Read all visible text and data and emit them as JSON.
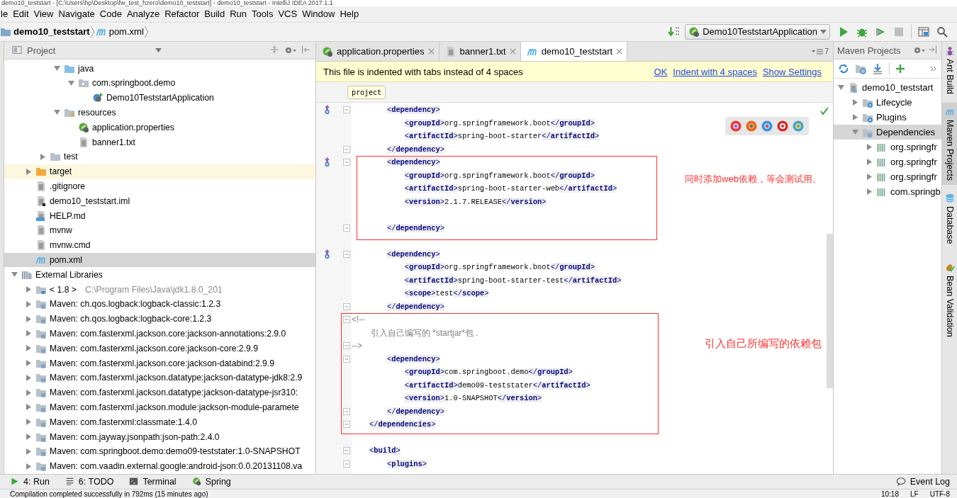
{
  "window": {
    "title": "demo10_teststart - [C:\\Users\\hp\\Desktop\\fw_test_hzero\\demo10_teststart] - demo10_teststart - IntelliJ IDEA 2017.1.1"
  },
  "menu": [
    "le",
    "Edit",
    "View",
    "Navigate",
    "Code",
    "Analyze",
    "Refactor",
    "Build",
    "Run",
    "Tools",
    "VCS",
    "Window",
    "Help"
  ],
  "navigation": {
    "breadcrumbs": [
      {
        "label": "demo10_teststart",
        "kind": "project"
      },
      {
        "label": "pom.xml",
        "kind": "maven"
      }
    ],
    "run_config": "Demo10TeststartApplication"
  },
  "project_panel": {
    "title": "Project",
    "tree": [
      {
        "children": [
          {
            "children": [
              {
                "children": [
                  {
                    "label": "java",
                    "kind": "source",
                    "expanded": true,
                    "selected": false,
                    "excluded": false,
                    "children": [
                      {
                        "label": "com.springboot.demo",
                        "kind": "package",
                        "expanded": true,
                        "selected": false,
                        "excluded": false,
                        "children": [
                          {
                            "label": "Demo10TeststartApplication",
                            "kind": "class",
                            "selected": false,
                            "excluded": false
                          }
                        ]
                      }
                    ]
                  },
                  {
                    "label": "resources",
                    "kind": "resources",
                    "expanded": true,
                    "selected": false,
                    "excluded": false,
                    "children": [
                      {
                        "label": "application.properties",
                        "kind": "spring",
                        "selected": false,
                        "excluded": false
                      },
                      {
                        "label": "banner1.txt",
                        "kind": "text",
                        "selected": false,
                        "excluded": false
                      }
                    ]
                  }
                ]
              },
              {
                "label": "test",
                "kind": "folder",
                "expanded": false,
                "selected": false,
                "excluded": false
              }
            ]
          },
          {
            "label": "target",
            "kind": "target",
            "expanded": false,
            "selected": false,
            "excluded": true
          },
          {
            "label": ".gitignore",
            "kind": "text",
            "selected": false,
            "excluded": false
          },
          {
            "label": "demo10_teststart.iml",
            "kind": "iml",
            "selected": false,
            "excluded": false
          },
          {
            "label": "HELP.md",
            "kind": "md",
            "selected": false,
            "excluded": false
          },
          {
            "label": "mvnw",
            "kind": "text",
            "selected": false,
            "excluded": false
          },
          {
            "label": "mvnw.cmd",
            "kind": "text",
            "selected": false,
            "excluded": false
          },
          {
            "label": "pom.xml",
            "kind": "maven",
            "selected": true,
            "excluded": false
          }
        ]
      },
      {
        "label": "External Libraries",
        "kind": "libraries",
        "expanded": true,
        "selected": false,
        "excluded": false,
        "children": [
          {
            "label": "< 1.8 >",
            "detail": "C:\\Program Files\\Java\\jdk1.8.0_201",
            "kind": "jdk",
            "expanded": false,
            "selected": false,
            "excluded": false
          },
          {
            "label": "Maven: ch.qos.logback:logback-classic:1.2.3",
            "kind": "library",
            "expanded": false,
            "selected": false,
            "excluded": false
          },
          {
            "label": "Maven: ch.qos.logback:logback-core:1.2.3",
            "kind": "library",
            "expanded": false,
            "selected": false,
            "excluded": false
          },
          {
            "label": "Maven: com.fasterxml.jackson.core:jackson-annotations:2.9.0",
            "kind": "library",
            "expanded": false,
            "selected": false,
            "excluded": false
          },
          {
            "label": "Maven: com.fasterxml.jackson.core:jackson-core:2.9.9",
            "kind": "library",
            "expanded": false,
            "selected": false,
            "excluded": false
          },
          {
            "label": "Maven: com.fasterxml.jackson.core:jackson-databind:2.9.9",
            "kind": "library",
            "expanded": false,
            "selected": false,
            "excluded": false
          },
          {
            "label": "Maven: com.fasterxml.jackson.datatype:jackson-datatype-jdk8:2.9",
            "kind": "library",
            "expanded": false,
            "selected": false,
            "excluded": false
          },
          {
            "label": "Maven: com.fasterxml.jackson.datatype:jackson-datatype-jsr310:",
            "kind": "library",
            "expanded": false,
            "selected": false,
            "excluded": false
          },
          {
            "label": "Maven: com.fasterxml.jackson.module:jackson-module-paramete",
            "kind": "library",
            "expanded": false,
            "selected": false,
            "excluded": false
          },
          {
            "label": "Maven: com.fasterxml:classmate:1.4.0",
            "kind": "library",
            "expanded": false,
            "selected": false,
            "excluded": false
          },
          {
            "label": "Maven: com.jayway.jsonpath:json-path:2.4.0",
            "kind": "library",
            "expanded": false,
            "selected": false,
            "excluded": false
          },
          {
            "label": "Maven: com.springboot.demo:demo09-teststater:1.0-SNAPSHOT",
            "kind": "library",
            "expanded": false,
            "selected": false,
            "excluded": false
          },
          {
            "label": "Maven: com.vaadin.external.google:android-json:0.0.20131108.va",
            "kind": "library",
            "expanded": false,
            "selected": false,
            "excluded": false
          }
        ]
      }
    ]
  },
  "editor": {
    "tabs": [
      {
        "label": "application.properties",
        "kind": "spring",
        "selected": false
      },
      {
        "label": "banner1.txt",
        "kind": "text",
        "selected": false
      },
      {
        "label": "demo10_teststart",
        "kind": "maven",
        "selected": true
      }
    ],
    "tab_count": "7",
    "notice": {
      "text": "This file is indented with tabs instead of 4 spaces",
      "links": [
        "OK",
        "Indent with 4 spaces",
        "Show Settings"
      ]
    },
    "breadcrumb": "project",
    "blocks": [
      {
        "kind": "plain",
        "lines": [
          {
            "kind": "code",
            "text": "        <dependency>",
            "override": true,
            "fold": true
          },
          {
            "kind": "code",
            "text": "            <groupId>org.springframework.boot</groupId>",
            "override": false,
            "fold": false
          },
          {
            "kind": "code",
            "text": "            <artifactId>spring-boot-starter</artifactId>",
            "override": false,
            "fold": false
          },
          {
            "kind": "code",
            "text": "        </dependency>",
            "override": false,
            "fold": true
          }
        ]
      },
      {
        "kind": "annotated",
        "note": "同时添加web依赖，等会测试用。",
        "lines": [
          {
            "kind": "code",
            "text": "        <dependency>",
            "override": true,
            "fold": true
          },
          {
            "kind": "code",
            "text": "            <groupId>org.springframework.boot</groupId>",
            "override": false,
            "fold": false
          },
          {
            "kind": "code",
            "text": "            <artifactId>spring-boot-starter-web</artifactId>",
            "override": false,
            "fold": false
          },
          {
            "kind": "code",
            "text": "            <version>2.1.7.RELEASE</version>",
            "override": false,
            "fold": false
          },
          {
            "kind": "blank",
            "override": false,
            "fold": false
          },
          {
            "kind": "code",
            "text": "        </dependency>",
            "override": false,
            "fold": true
          }
        ]
      },
      {
        "kind": "plain",
        "lines": [
          {
            "kind": "blank",
            "override": false,
            "fold": false
          },
          {
            "kind": "code",
            "text": "        <dependency>",
            "override": true,
            "fold": true
          },
          {
            "kind": "code",
            "text": "            <groupId>org.springframework.boot</groupId>",
            "override": false,
            "fold": false
          },
          {
            "kind": "code",
            "text": "            <artifactId>spring-boot-starter-test</artifactId>",
            "override": false,
            "fold": false
          },
          {
            "kind": "code",
            "text": "            <scope>test</scope>",
            "override": false,
            "fold": false
          },
          {
            "kind": "code",
            "text": "        </dependency>",
            "override": false,
            "fold": true
          }
        ]
      },
      {
        "kind": "annotated",
        "note": "引入自己所编写的依赖包",
        "lines": [
          {
            "kind": "comment",
            "text": "<!--",
            "override": false,
            "fold": true
          },
          {
            "kind": "comment",
            "text": "        引入自己编写的 *startjar*包 .",
            "override": false,
            "fold": false
          },
          {
            "kind": "comment",
            "text": "-->",
            "override": false,
            "fold": true
          },
          {
            "kind": "code",
            "text": "        <dependency>",
            "override": false,
            "fold": true
          },
          {
            "kind": "code",
            "text": "            <groupId>com.springboot.demo</groupId>",
            "override": false,
            "fold": false
          },
          {
            "kind": "code",
            "text": "            <artifactId>demo09-teststater</artifactId>",
            "override": false,
            "fold": false
          },
          {
            "kind": "code",
            "text": "            <version>1.0-SNAPSHOT</version>",
            "override": false,
            "fold": false
          },
          {
            "kind": "code",
            "text": "        </dependency>",
            "override": false,
            "fold": true
          },
          {
            "kind": "code",
            "text": "    </dependencies>",
            "override": false,
            "fold": true
          }
        ]
      },
      {
        "kind": "plain",
        "lines": [
          {
            "kind": "blank",
            "override": false,
            "fold": false
          },
          {
            "kind": "code",
            "text": "    <build>",
            "override": false,
            "fold": true
          },
          {
            "kind": "code",
            "text": "        <plugins>",
            "override": false,
            "fold": true
          }
        ]
      }
    ]
  },
  "maven_panel": {
    "title": "Maven Projects",
    "tree": [
      {
        "label": "demo10_teststart",
        "kind": "module",
        "expanded": true,
        "selected": false,
        "children": [
          {
            "label": "Lifecycle",
            "kind": "config-folder",
            "expanded": false,
            "selected": false
          },
          {
            "label": "Plugins",
            "kind": "config-folder",
            "expanded": false,
            "selected": false
          },
          {
            "label": "Dependencies",
            "kind": "deps-folder",
            "expanded": true,
            "selected": true,
            "children": [
              {
                "label": "org.springfr",
                "kind": "dependency",
                "expanded": false,
                "selected": false
              },
              {
                "label": "org.springfr",
                "kind": "dependency",
                "expanded": false,
                "selected": false
              },
              {
                "label": "org.springfr",
                "kind": "dependency",
                "expanded": false,
                "selected": false
              },
              {
                "label": "com.springb",
                "kind": "dependency",
                "expanded": false,
                "selected": false
              }
            ]
          }
        ]
      }
    ]
  },
  "side_tabs": [
    {
      "label": "Ant Build",
      "kind": "ant",
      "selected": false
    },
    {
      "label": "Maven Projects",
      "kind": "maven",
      "selected": true
    },
    {
      "label": "Database",
      "kind": "database",
      "selected": false
    },
    {
      "label": "Bean Validation",
      "kind": "bean",
      "selected": false
    }
  ],
  "tool_windows": [
    {
      "label": "4: Run",
      "kind": "run"
    },
    {
      "label": "6: TODO",
      "kind": "todo"
    },
    {
      "label": "Terminal",
      "kind": "terminal"
    },
    {
      "label": "Spring",
      "kind": "spring"
    }
  ],
  "event_log": "Event Log",
  "status_bar": {
    "message": "Compilation completed successfully in 792ms (15 minutes ago)",
    "position": "10:18",
    "line_separator": "LF",
    "encoding": "UTF-8"
  }
}
